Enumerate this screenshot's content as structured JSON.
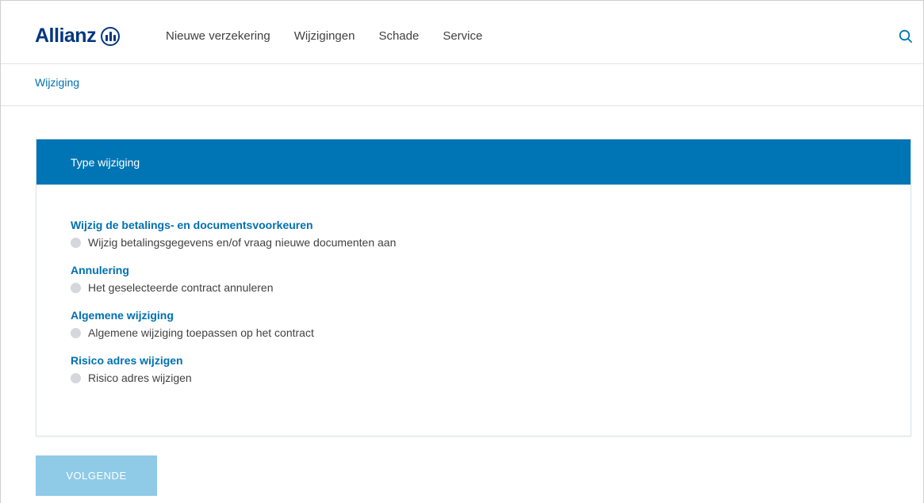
{
  "header": {
    "logo_text": "Allianz",
    "nav": [
      "Nieuwe verzekering",
      "Wijzigingen",
      "Schade",
      "Service"
    ],
    "search_icon": "search-icon"
  },
  "breadcrumb": "Wijziging",
  "panel": {
    "title": "Type wijziging",
    "groups": [
      {
        "title": "Wijzig de betalings- en documentsvoorkeuren",
        "option": "Wijzig betalingsgegevens en/of vraag nieuwe documenten aan"
      },
      {
        "title": "Annulering",
        "option": "Het geselecteerde contract annuleren"
      },
      {
        "title": "Algemene wijziging",
        "option": "Algemene wijziging toepassen op het contract"
      },
      {
        "title": "Risico adres wijzigen",
        "option": "Risico adres wijzigen"
      }
    ]
  },
  "next_button": "VOLGENDE",
  "colors": {
    "brand": "#003781",
    "accent": "#0075b5",
    "link": "#0070b0",
    "button_disabled": "#8fcbe6"
  }
}
